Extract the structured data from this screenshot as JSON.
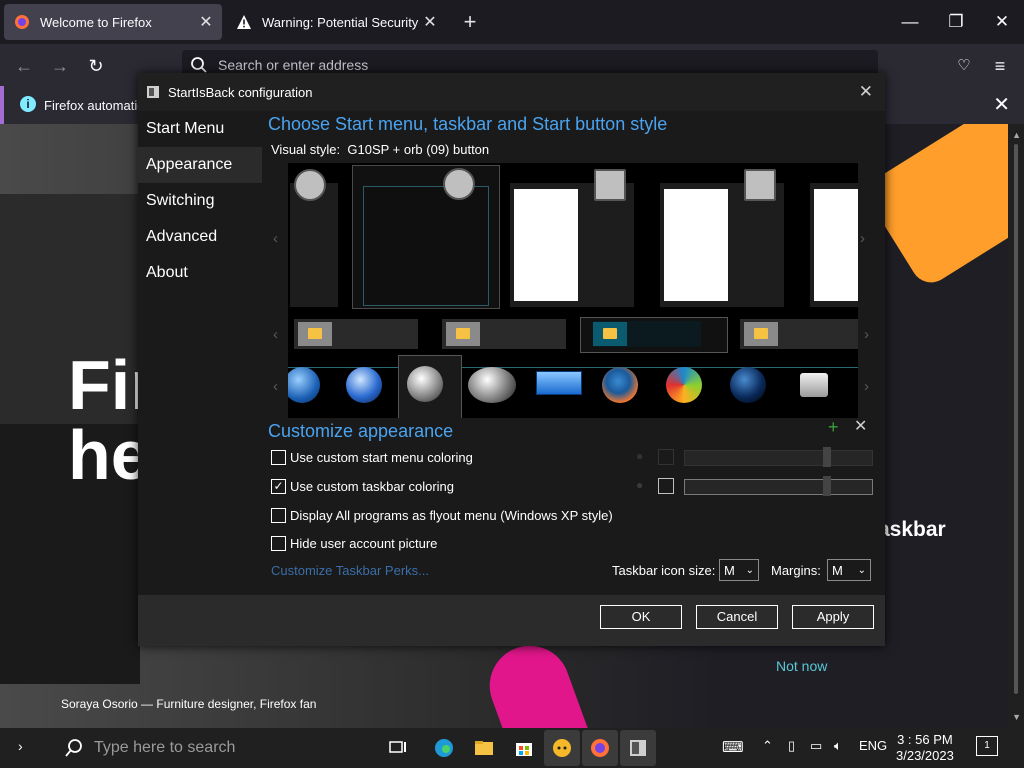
{
  "browser": {
    "tabs": [
      {
        "title": "Welcome to Firefox",
        "active": true
      },
      {
        "title": "Warning: Potential Security Risk",
        "active": false
      }
    ],
    "address_placeholder": "Search or enter address",
    "notification": "Firefox automatic"
  },
  "page": {
    "hero_line1": "Fir",
    "hero_line2": "he",
    "side_text": "askbar",
    "not_now": "Not now",
    "caption": "Soraya Osorio — Furniture designer, Firefox fan"
  },
  "dialog": {
    "title": "StartIsBack configuration",
    "nav": [
      "Start Menu",
      "Appearance",
      "Switching",
      "Advanced",
      "About"
    ],
    "selected_nav": "Appearance",
    "heading_style": "Choose Start menu, taskbar and Start button style",
    "visual_style_label": "Visual style:",
    "visual_style_value": "G10SP + orb (09) button",
    "heading_customize": "Customize appearance",
    "options": [
      {
        "label": "Use custom start menu coloring",
        "checked": false
      },
      {
        "label": "Use custom taskbar coloring",
        "checked": true
      },
      {
        "label": "Display All programs as flyout menu (Windows XP style)",
        "checked": false
      },
      {
        "label": "Hide user account picture",
        "checked": false
      }
    ],
    "perks_link": "Customize Taskbar Perks...",
    "icon_size_label": "Taskbar icon size:",
    "icon_size_value": "M",
    "margins_label": "Margins:",
    "margins_value": "M",
    "buttons": {
      "ok": "OK",
      "cancel": "Cancel",
      "apply": "Apply"
    },
    "colors": {
      "accent": "#4aa3f0",
      "background": "#1a1a1a"
    }
  },
  "taskbar": {
    "search_placeholder": "Type here to search",
    "language": "ENG",
    "time": "3 : 56 PM",
    "date": "3/23/2023",
    "notification_count": "1"
  }
}
